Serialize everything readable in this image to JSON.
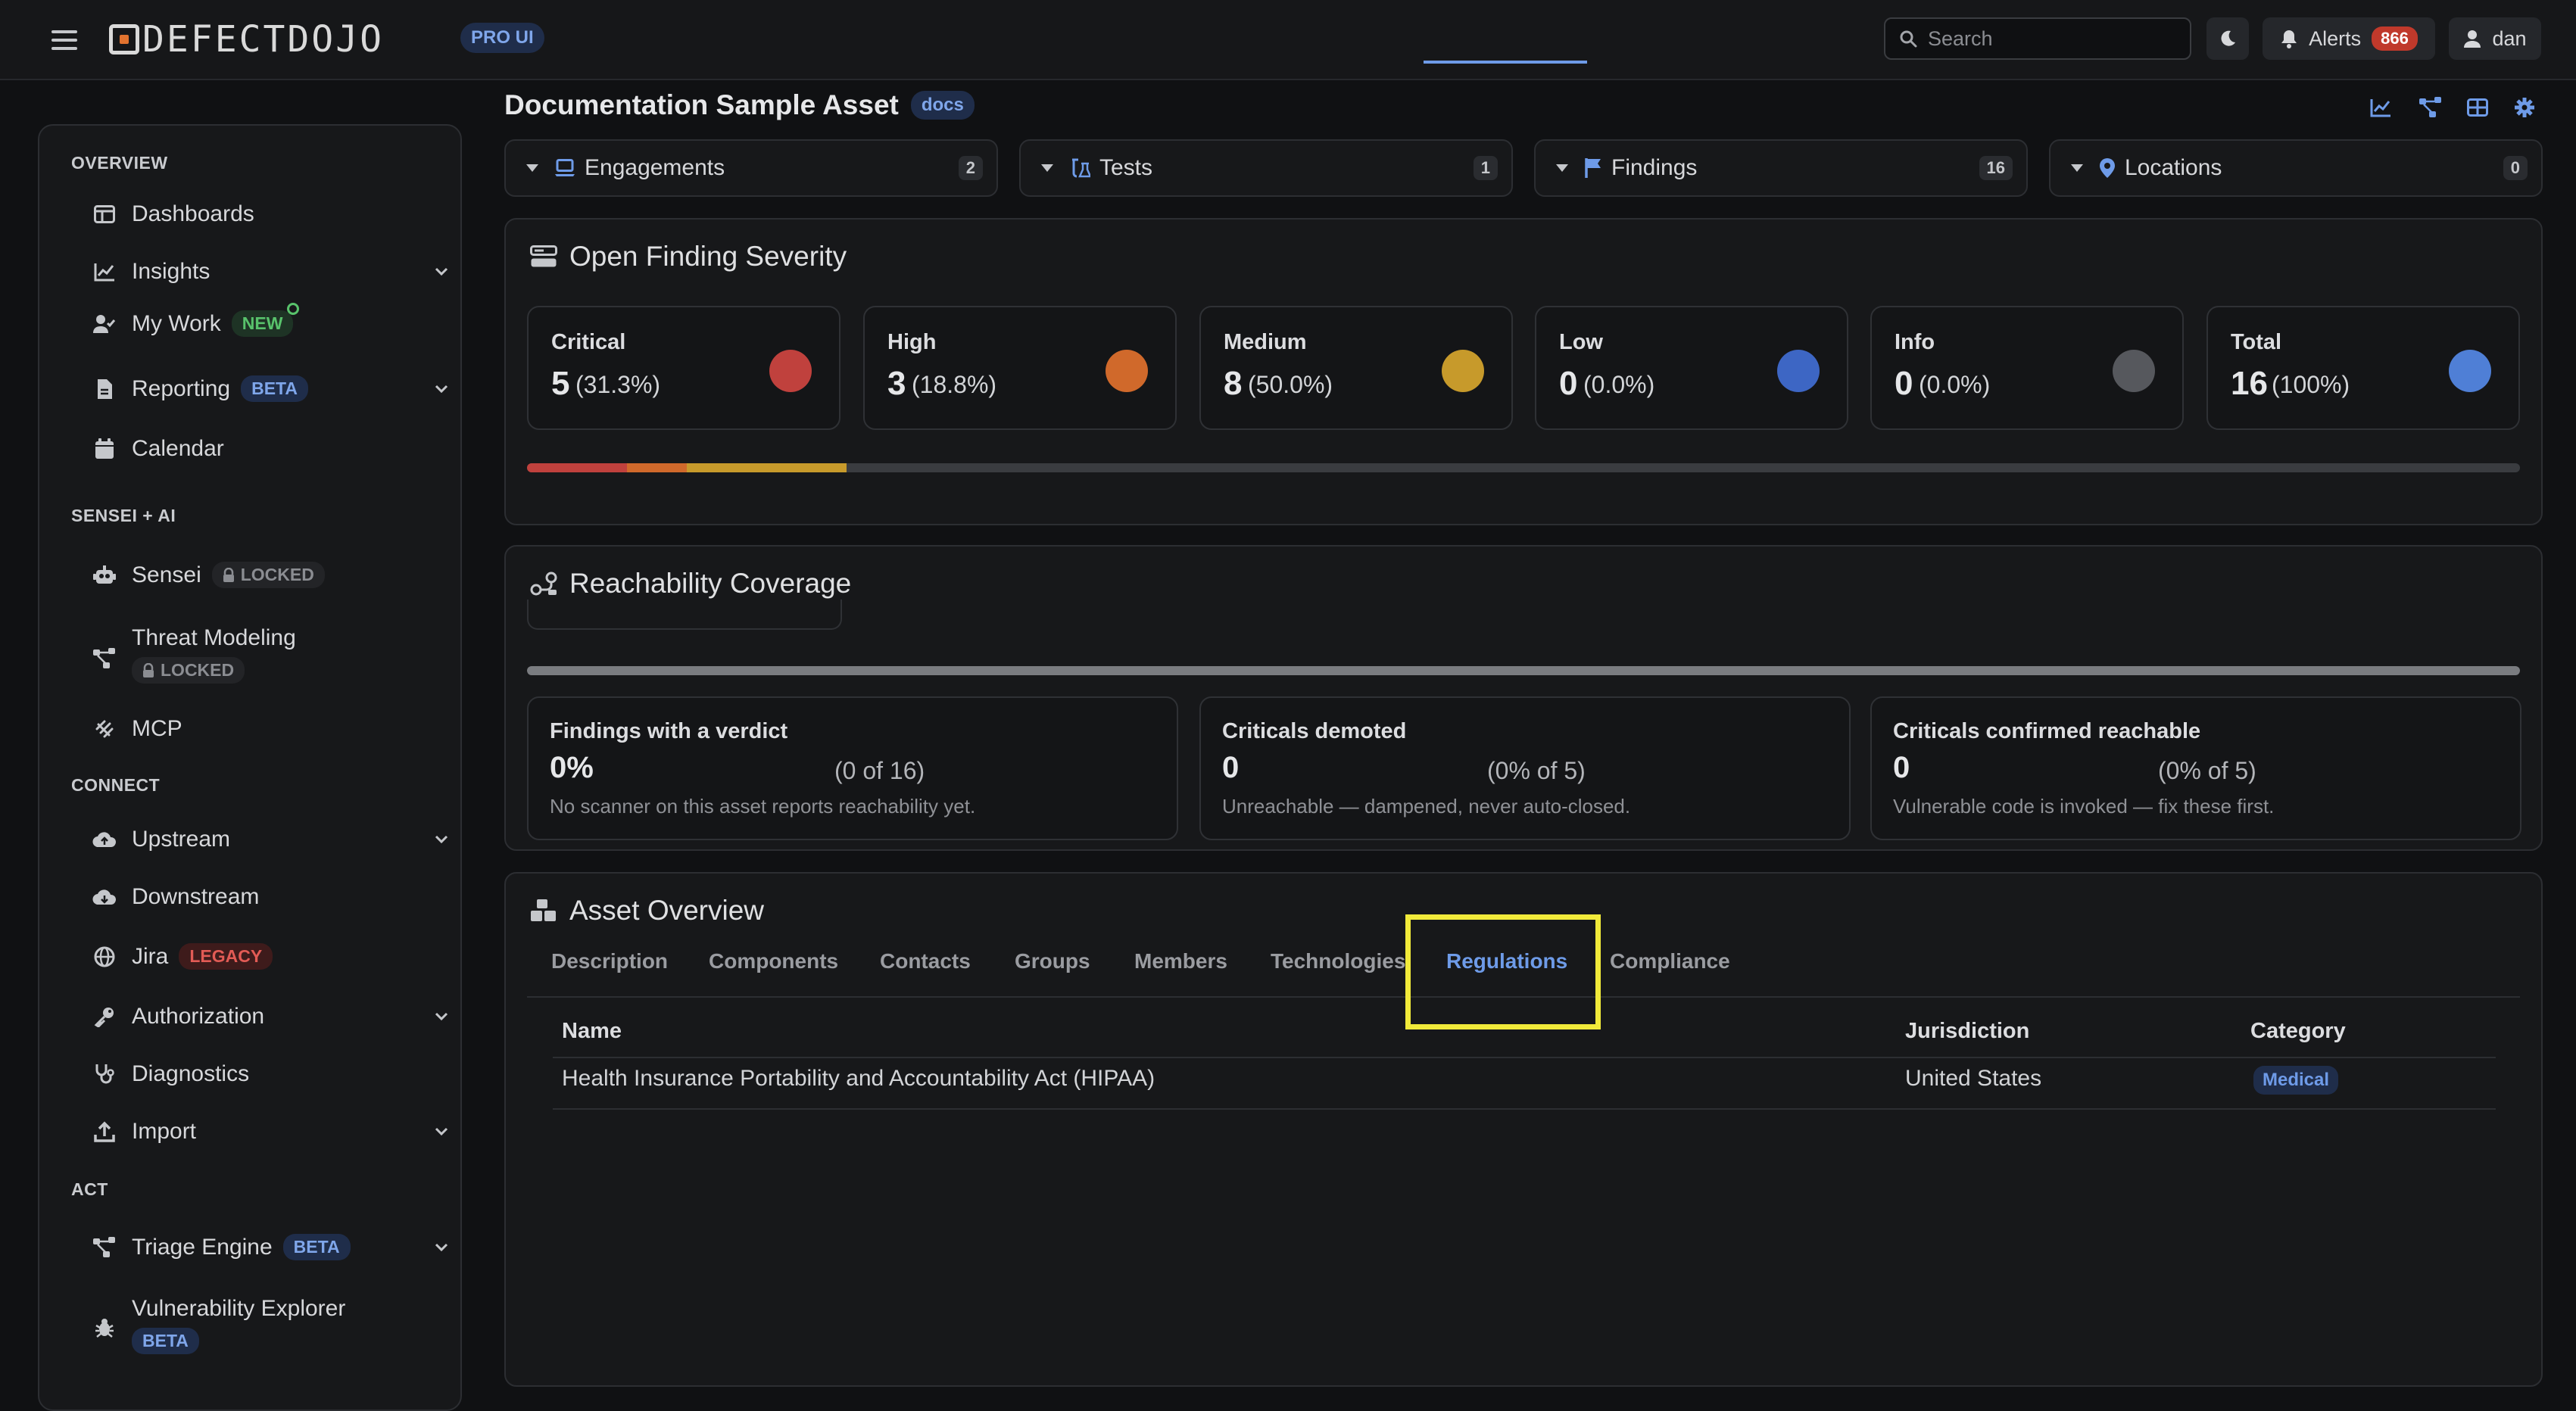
{
  "header": {
    "logo_text": "DEFECTDOJO",
    "pro_badge": "PRO UI",
    "search_placeholder": "Search",
    "alerts_label": "Alerts",
    "alerts_count": "866",
    "user_name": "dan"
  },
  "sidebar": {
    "sections": {
      "overview": "OVERVIEW",
      "sensei": "SENSEI + AI",
      "connect": "CONNECT",
      "act": "ACT"
    },
    "items": {
      "dashboards": "Dashboards",
      "insights": "Insights",
      "my_work": "My Work",
      "my_work_tag": "NEW",
      "reporting": "Reporting",
      "reporting_tag": "BETA",
      "calendar": "Calendar",
      "sensei": "Sensei",
      "sensei_tag": "LOCKED",
      "threat_modeling": "Threat Modeling",
      "threat_modeling_tag": "LOCKED",
      "mcp": "MCP",
      "upstream": "Upstream",
      "downstream": "Downstream",
      "jira": "Jira",
      "jira_tag": "LEGACY",
      "authorization": "Authorization",
      "diagnostics": "Diagnostics",
      "import": "Import",
      "triage_engine": "Triage Engine",
      "triage_engine_tag": "BETA",
      "vulnerability_explorer": "Vulnerability Explorer",
      "vulnerability_explorer_tag": "BETA"
    }
  },
  "asset": {
    "title": "Documentation Sample Asset",
    "badge": "docs"
  },
  "summary_pills": {
    "engagements": {
      "label": "Engagements",
      "count": "2"
    },
    "tests": {
      "label": "Tests",
      "count": "1"
    },
    "findings": {
      "label": "Findings",
      "count": "16"
    },
    "locations": {
      "label": "Locations",
      "count": "0"
    }
  },
  "severity": {
    "title": "Open Finding Severity",
    "cards": {
      "critical": {
        "label": "Critical",
        "value": "5",
        "pct": "(31.3%)",
        "color": "#c0413d"
      },
      "high": {
        "label": "High",
        "value": "3",
        "pct": "(18.8%)",
        "color": "#d0692b"
      },
      "medium": {
        "label": "Medium",
        "value": "8",
        "pct": "(50.0%)",
        "color": "#c79a2b"
      },
      "low": {
        "label": "Low",
        "value": "0",
        "pct": "(0.0%)",
        "color": "#3d66c4"
      },
      "info": {
        "label": "Info",
        "value": "0",
        "pct": "(0.0%)",
        "color": "#56585d"
      },
      "total": {
        "label": "Total",
        "value": "16",
        "pct": "(100%)",
        "color": "#4f7fd6"
      }
    },
    "bar_fill": {
      "critical": 0.05,
      "high": 0.03,
      "medium": 0.08
    }
  },
  "reachability": {
    "title": "Reachability Coverage",
    "cards": {
      "verdict": {
        "label": "Findings with a verdict",
        "value": "0%",
        "sub": "(0 of 16)",
        "note": "No scanner on this asset reports reachability yet."
      },
      "demoted": {
        "label": "Criticals demoted",
        "value": "0",
        "sub": "(0% of 5)",
        "note": "Unreachable — dampened, never auto-closed."
      },
      "confirmed": {
        "label": "Criticals confirmed reachable",
        "value": "0",
        "sub": "(0% of 5)",
        "note": "Vulnerable code is invoked — fix these first."
      }
    }
  },
  "overview": {
    "title": "Asset Overview",
    "tabs": {
      "description": "Description",
      "components": "Components",
      "contacts": "Contacts",
      "groups": "Groups",
      "members": "Members",
      "technologies": "Technologies",
      "regulations": "Regulations",
      "compliance": "Compliance"
    },
    "active_tab": "Regulations",
    "table": {
      "headers": {
        "name": "Name",
        "jurisdiction": "Jurisdiction",
        "category": "Category"
      },
      "rows": [
        {
          "name": "Health Insurance Portability and Accountability Act (HIPAA)",
          "jurisdiction": "United States",
          "category": "Medical"
        }
      ]
    }
  }
}
